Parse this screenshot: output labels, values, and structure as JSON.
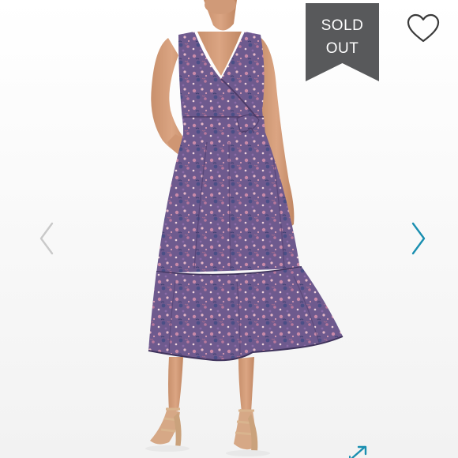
{
  "listing": {
    "status_badge": {
      "line1": "SOLD",
      "line2": "OUT"
    },
    "product_image": "dress-photo",
    "status_badge_color": "#58595b",
    "accent_color": "#1a8fb0"
  },
  "icons": {
    "like": "heart-outline-icon",
    "previous": "chevron-left-icon",
    "next": "chevron-right-icon",
    "expand": "expand-arrow-icon"
  }
}
